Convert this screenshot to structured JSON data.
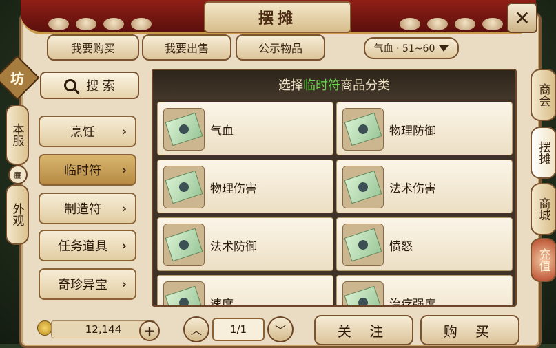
{
  "header": {
    "title": "摆摊"
  },
  "top_tabs": [
    {
      "label": "我要购买"
    },
    {
      "label": "我要出售"
    },
    {
      "label": "公示物品"
    }
  ],
  "level_filter": {
    "label": "气血 · 51~60"
  },
  "left_tabs": {
    "badge": "坊",
    "local_server": "本服",
    "appearance": "外观"
  },
  "search": {
    "label": "搜 索"
  },
  "categories": [
    {
      "label": "烹饪"
    },
    {
      "label": "临时符",
      "selected": true
    },
    {
      "label": "制造符"
    },
    {
      "label": "任务道具"
    },
    {
      "label": "奇珍异宝"
    }
  ],
  "list": {
    "header_prefix": "选择",
    "header_highlight": "临时符",
    "header_suffix": "商品分类",
    "items": [
      {
        "name": "气血"
      },
      {
        "name": "物理防御"
      },
      {
        "name": "物理伤害"
      },
      {
        "name": "法术伤害"
      },
      {
        "name": "法术防御"
      },
      {
        "name": "愤怒"
      },
      {
        "name": "速度"
      },
      {
        "name": "治疗强度"
      }
    ]
  },
  "footer": {
    "gold": "12,144",
    "page": "1/1",
    "follow_label": "关 注",
    "buy_label": "购 买"
  },
  "right_tabs": [
    {
      "label": "商会"
    },
    {
      "label": "摆摊"
    },
    {
      "label": "商城"
    },
    {
      "label": "充值"
    }
  ],
  "colors": {
    "highlight_green": "#6ad24f",
    "selected_category": "#c9a35a",
    "frame_red": "#8f1f17"
  },
  "icons": [
    "close-icon",
    "search-icon",
    "chevron-right-icon",
    "caret-down-icon",
    "grid-icon",
    "coin-icon",
    "plus-icon",
    "arrow-up-icon",
    "arrow-down-icon",
    "talisman-icon"
  ]
}
